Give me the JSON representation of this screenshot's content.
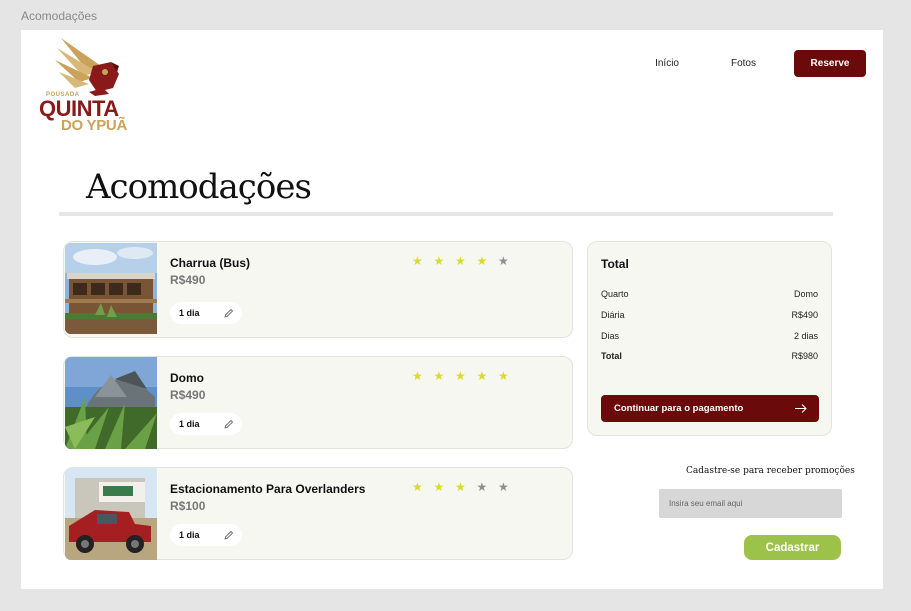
{
  "frame": {
    "title": "Acomodações"
  },
  "brand": {
    "line1": "POUSADA",
    "line2": "QUINTA",
    "line3": "DO YPUÃ",
    "primary": "#6b0a0a",
    "gold": "#c9a35a"
  },
  "nav": {
    "links": [
      "Início",
      "Fotos"
    ],
    "cta": "Reserve"
  },
  "page": {
    "heading": "Acomodações"
  },
  "rooms": [
    {
      "name": "Charrua (Bus)",
      "price": "R$490",
      "rating": 4,
      "days": "1 dia",
      "image": "bus-image"
    },
    {
      "name": "Domo",
      "price": "R$490",
      "rating": 5,
      "days": "1 dia",
      "image": "dome-image"
    },
    {
      "name": "Estacionamento Para Overlanders",
      "price": "R$100",
      "rating": 3,
      "days": "1 dia",
      "image": "truck-image"
    }
  ],
  "summary": {
    "title": "Total",
    "rows": [
      {
        "label": "Quarto",
        "value": "Domo"
      },
      {
        "label": "Diária",
        "value": "R$490"
      },
      {
        "label": "Dias",
        "value": "2 dias"
      },
      {
        "label": "Total",
        "value": "R$980"
      }
    ],
    "button": "Continuar para o pagamento"
  },
  "newsletter": {
    "label": "Cadastre-se para receber promoções",
    "placeholder": "Insira seu email aqui",
    "button": "Cadastrar",
    "button_color": "#9dc24a"
  }
}
